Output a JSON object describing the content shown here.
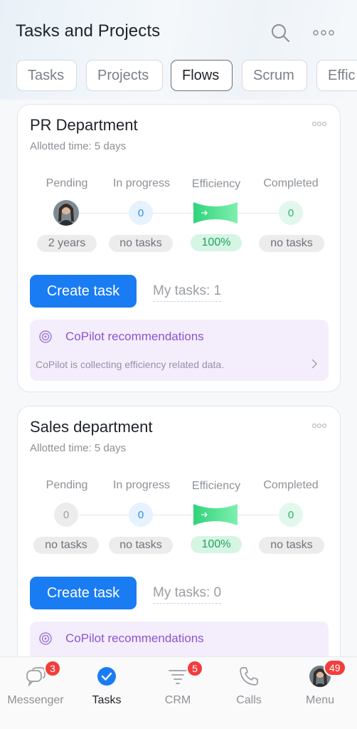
{
  "header": {
    "title": "Tasks and Projects"
  },
  "tabs": [
    "Tasks",
    "Projects",
    "Flows",
    "Scrum",
    "Effic"
  ],
  "stages": {
    "pending": "Pending",
    "in_progress": "In progress",
    "efficiency": "Efficiency",
    "completed": "Completed"
  },
  "cards": [
    {
      "title": "PR Department",
      "subtitle": "Allotted time: 5 days",
      "in_progress_count": "0",
      "completed_count": "0",
      "pending_pill": "2 years",
      "in_progress_pill": "no tasks",
      "efficiency_pill": "100%",
      "completed_pill": "no tasks",
      "create_button": "Create task",
      "my_tasks": "My tasks: 1",
      "copilot_title": "CoPilot recommendations",
      "copilot_text": "CoPilot is collecting efficiency related data."
    },
    {
      "title": "Sales department",
      "subtitle": "Allotted time: 5 days",
      "pending_count": "0",
      "in_progress_count": "0",
      "completed_count": "0",
      "pending_pill": "no tasks",
      "in_progress_pill": "no tasks",
      "efficiency_pill": "100%",
      "completed_pill": "no tasks",
      "create_button": "Create task",
      "my_tasks": "My tasks: 0",
      "copilot_title": "CoPilot recommendations"
    }
  ],
  "nav": [
    {
      "label": "Messenger",
      "badge": "3",
      "icon": "messenger-icon"
    },
    {
      "label": "Tasks",
      "icon": "tasks-check-icon"
    },
    {
      "label": "CRM",
      "badge": "5",
      "icon": "crm-funnel-icon"
    },
    {
      "label": "Calls",
      "icon": "phone-icon"
    },
    {
      "label": "Menu",
      "badge": "49",
      "icon": "avatar-icon"
    }
  ],
  "colors": {
    "accent": "#1a7cf2",
    "badge": "#f23d3d",
    "copilot": "#8b54d0",
    "efficiency": "#3ddc84"
  }
}
